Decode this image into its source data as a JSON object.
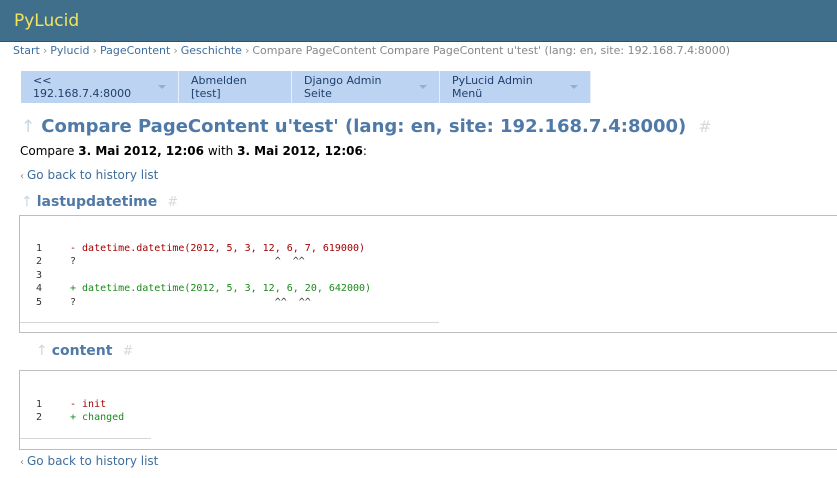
{
  "header": {
    "site_title": "PyLucid"
  },
  "breadcrumb": {
    "items": [
      "Start",
      "Pylucid",
      "PageContent",
      "Geschichte"
    ],
    "current": "Compare PageContent Compare PageContent u'test' (lang: en, site: 192.168.7.4:8000)",
    "separator": "›"
  },
  "menu": {
    "items": [
      {
        "label": "<< 192.168.7.4:8000",
        "has_dropdown": true
      },
      {
        "label": "Abmelden [test]",
        "has_dropdown": false
      },
      {
        "label": "Django Admin Seite",
        "has_dropdown": true
      },
      {
        "label": "PyLucid Admin Menü",
        "has_dropdown": true
      }
    ]
  },
  "page": {
    "up_arrow": "↑",
    "title": "Compare PageContent u'test' (lang: en, site: 192.168.7.4:8000)",
    "anchor": "#",
    "compare_prefix": "Compare ",
    "date_a": "3. Mai 2012, 12:06",
    "compare_mid": " with ",
    "date_b": "3. Mai 2012, 12:06",
    "compare_suffix": ":",
    "back_link": "Go back to history list",
    "back_chevron": "‹"
  },
  "sections": [
    {
      "heading": "lastupdatetime",
      "lines": [
        {
          "num": "1",
          "text": "- datetime.datetime(2012, 5, 3, 12, 6, 7, 619000)",
          "kind": "del"
        },
        {
          "num": "2",
          "text": "?                                 ^  ^^",
          "kind": "ctx"
        },
        {
          "num": "3",
          "text": "",
          "kind": "ctx"
        },
        {
          "num": "4",
          "text": "+ datetime.datetime(2012, 5, 3, 12, 6, 20, 642000)",
          "kind": "add"
        },
        {
          "num": "5",
          "text": "?                                 ^^  ^^",
          "kind": "ctx"
        }
      ]
    },
    {
      "heading": "content",
      "lines": [
        {
          "num": "1",
          "text": "- init",
          "kind": "del"
        },
        {
          "num": "2",
          "text": "+ changed",
          "kind": "add"
        }
      ]
    }
  ],
  "colors": {
    "header_bg": "#3f6f8a",
    "site_title": "#f2e55c",
    "menu_bg": "#bcd4f2",
    "link": "#3e6e9c",
    "heading": "#4f79a6",
    "diff_del": "#a30000",
    "diff_add": "#1a8a1a"
  }
}
